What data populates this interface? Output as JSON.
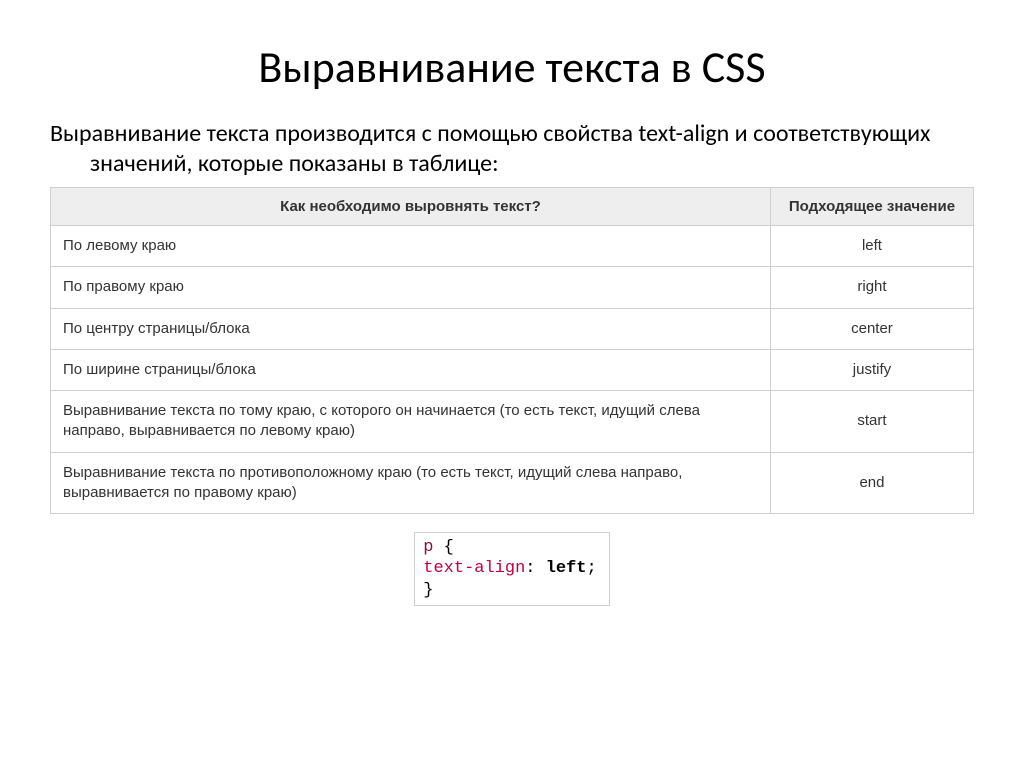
{
  "title": "Выравнивание текста в CSS",
  "intro": "Выравнивание текста производится с помощью свойства text-align и соответствующих значений, которые показаны в таблице:",
  "table": {
    "header_desc": "Как необходимо выровнять текст?",
    "header_val": "Подходящее значение",
    "rows": [
      {
        "desc": "По левому краю",
        "val": "left"
      },
      {
        "desc": "По правому краю",
        "val": "right"
      },
      {
        "desc": "По центру страницы/блока",
        "val": "center"
      },
      {
        "desc": "По ширине страницы/блока",
        "val": "justify"
      },
      {
        "desc": "Выравнивание текста по тому краю, с которого он начинается (то есть текст, идущий слева направо, выравнивается по левому краю)",
        "val": "start"
      },
      {
        "desc": "Выравнивание текста по противоположному краю (то есть текст, идущий слева направо, выравнивается по правому краю)",
        "val": "end"
      }
    ]
  },
  "code": {
    "selector": "p",
    "open": " {",
    "property": "text-align",
    "colon": ": ",
    "value": "left",
    "semi": ";",
    "close": "}"
  }
}
